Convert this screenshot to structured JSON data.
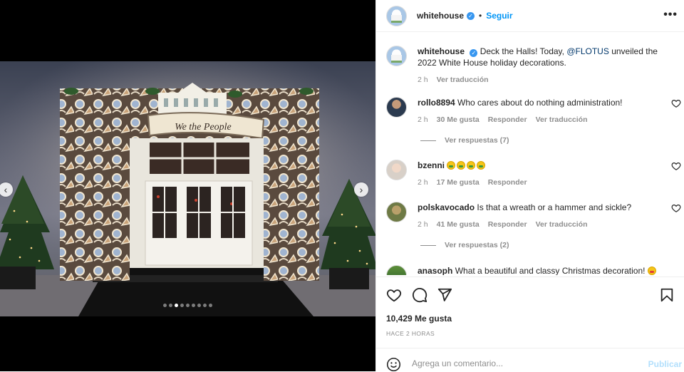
{
  "carousel": {
    "prev_icon": "chevron-left-icon",
    "next_icon": "chevron-right-icon",
    "slide_count": 9,
    "active_slide": 3,
    "banner_text": "We the People"
  },
  "header": {
    "username": "whitehouse",
    "separator": "•",
    "follow_label": "Seguir",
    "more_icon": "more-options-icon",
    "more_glyph": "•••"
  },
  "caption": {
    "username": "whitehouse",
    "text_before": "Deck the Halls! Today, ",
    "mention": "@FLOTUS",
    "text_after": " unveiled the 2022 White House holiday decorations.",
    "time": "2 h",
    "translate": "Ver traducción"
  },
  "comments": [
    {
      "username": "rollo8894",
      "text": "Who cares about do nothing administration!",
      "time": "2 h",
      "likes": "30 Me gusta",
      "reply": "Responder",
      "translate": "Ver traducción",
      "replies": "Ver respuestas (7)"
    },
    {
      "username": "bzenni",
      "text": "",
      "emoji_count": 4,
      "time": "2 h",
      "likes": "17 Me gusta",
      "reply": "Responder"
    },
    {
      "username": "polskavocado",
      "text": "Is that a wreath or a hammer and sickle?",
      "time": "2 h",
      "likes": "41 Me gusta",
      "reply": "Responder",
      "translate": "Ver traducción",
      "replies": "Ver respuestas (2)"
    },
    {
      "username": "anasoph",
      "text": "What a beautiful and classy Christmas decoration!"
    }
  ],
  "actions": {
    "like_icon": "heart-icon",
    "comment_icon": "comment-icon",
    "share_icon": "share-icon",
    "save_icon": "bookmark-icon",
    "likes": "10,429 Me gusta",
    "time_ago": "HACE 2 HORAS"
  },
  "add_comment": {
    "emoji_icon": "smile-icon",
    "placeholder": "Agrega un comentario...",
    "publish_label": "Publicar"
  },
  "colors": {
    "link_blue": "#0095f6",
    "publish_disabled": "#b2dffc",
    "muted": "#8e8e8e",
    "text": "#262626",
    "verified": "#3897f0"
  }
}
